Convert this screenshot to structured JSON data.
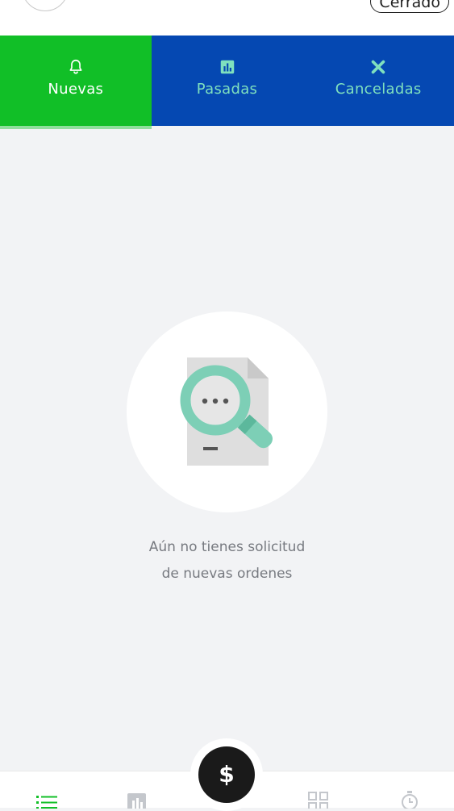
{
  "header": {
    "status_label": "Cerrado"
  },
  "tabs": [
    {
      "label": "Nuevas",
      "icon": "bell-icon",
      "active": true
    },
    {
      "label": "Pasadas",
      "icon": "chart-icon",
      "active": false
    },
    {
      "label": "Canceladas",
      "icon": "x-icon",
      "active": false
    }
  ],
  "empty_state": {
    "line1": "Aún no tienes solicitud",
    "line2": "de nuevas ordenes"
  },
  "fab": {
    "label": "$"
  },
  "bottom_nav": [
    {
      "icon": "list-icon",
      "active": true
    },
    {
      "icon": "chart-icon",
      "active": false
    },
    {
      "icon": "grid-icon",
      "active": false
    },
    {
      "icon": "stopwatch-icon",
      "active": false
    }
  ],
  "colors": {
    "active_tab": "#11bf27",
    "tab_bar": "#0548b2",
    "inactive_tab_text": "#7fe0be",
    "illustration_accent": "#7dcfb6"
  }
}
